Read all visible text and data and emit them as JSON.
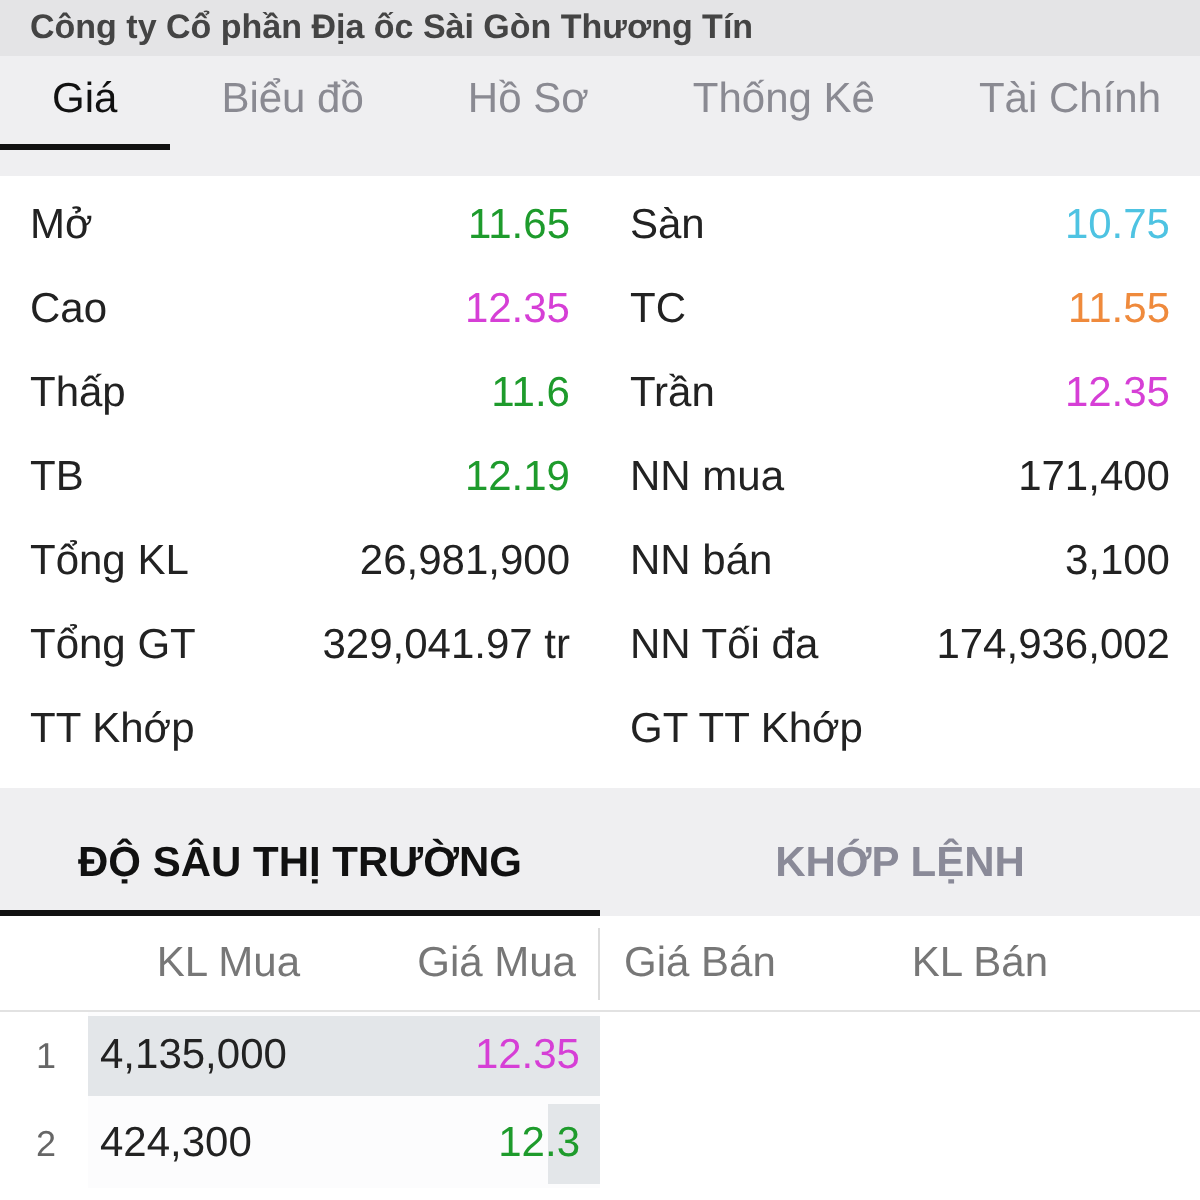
{
  "title": "Công ty Cổ phần Địa ốc Sài Gòn Thương Tín",
  "tabs": [
    {
      "label": "Giá",
      "selected": true
    },
    {
      "label": "Biểu đồ",
      "selected": false
    },
    {
      "label": "Hồ Sơ",
      "selected": false
    },
    {
      "label": "Thống Kê",
      "selected": false
    },
    {
      "label": "Tài Chính",
      "selected": false
    }
  ],
  "stats": [
    {
      "left": {
        "label": "Mở",
        "value": "11.65",
        "color": "#1e9b2c"
      },
      "right": {
        "label": "Sàn",
        "value": "10.75",
        "color": "#4ec3e2"
      }
    },
    {
      "left": {
        "label": "Cao",
        "value": "12.35",
        "color": "#d63fd6"
      },
      "right": {
        "label": "TC",
        "value": "11.55",
        "color": "#ef8a3c"
      }
    },
    {
      "left": {
        "label": "Thấp",
        "value": "11.6",
        "color": "#1e9b2c"
      },
      "right": {
        "label": "Trần",
        "value": "12.35",
        "color": "#d63fd6"
      }
    },
    {
      "left": {
        "label": "TB",
        "value": "12.19",
        "color": "#1e9b2c"
      },
      "right": {
        "label": "NN mua",
        "value": "171,400",
        "color": "#222222"
      }
    },
    {
      "left": {
        "label": "Tổng KL",
        "value": "26,981,900",
        "color": "#222222"
      },
      "right": {
        "label": "NN bán",
        "value": "3,100",
        "color": "#222222"
      }
    },
    {
      "left": {
        "label": "Tổng GT",
        "value": "329,041.97 tr",
        "color": "#222222"
      },
      "right": {
        "label": "NN Tối đa",
        "value": "174,936,002",
        "color": "#222222"
      }
    },
    {
      "left": {
        "label": "TT Khớp"
      },
      "right": {
        "label": "GT TT Khớp"
      }
    }
  ],
  "depth_tabs": [
    {
      "label": "ĐỘ SÂU THỊ TRƯỜNG",
      "selected": true
    },
    {
      "label": "KHỚP LỆNH",
      "selected": false
    }
  ],
  "depth_columns": [
    "KL Mua",
    "Giá Mua",
    "Giá Bán",
    "KL Bán"
  ],
  "depth_rows": [
    {
      "index": "1",
      "buy_volume": "4,135,000",
      "buy_price": "12.35",
      "color": "#d63fd6",
      "level": 1
    },
    {
      "index": "2",
      "buy_volume": "424,300",
      "buy_price": "12.3",
      "color": "#1e9b2c",
      "level": 0.1
    }
  ]
}
